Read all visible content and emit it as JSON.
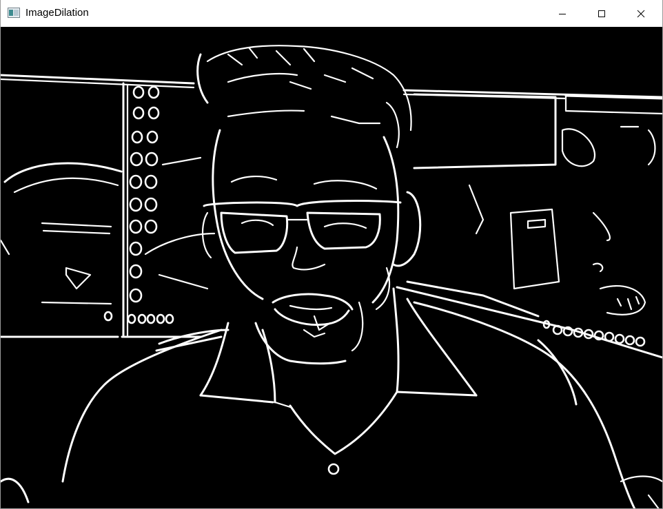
{
  "window": {
    "title": "ImageDilation",
    "app_icon": "opencv-window-icon",
    "controls": {
      "minimize_icon": "minimize-icon",
      "maximize_icon": "maximize-icon",
      "close_icon": "close-icon"
    }
  },
  "image": {
    "description_icon": "dilated-edge-image",
    "background_color": "#000000",
    "edge_color": "#ffffff"
  }
}
